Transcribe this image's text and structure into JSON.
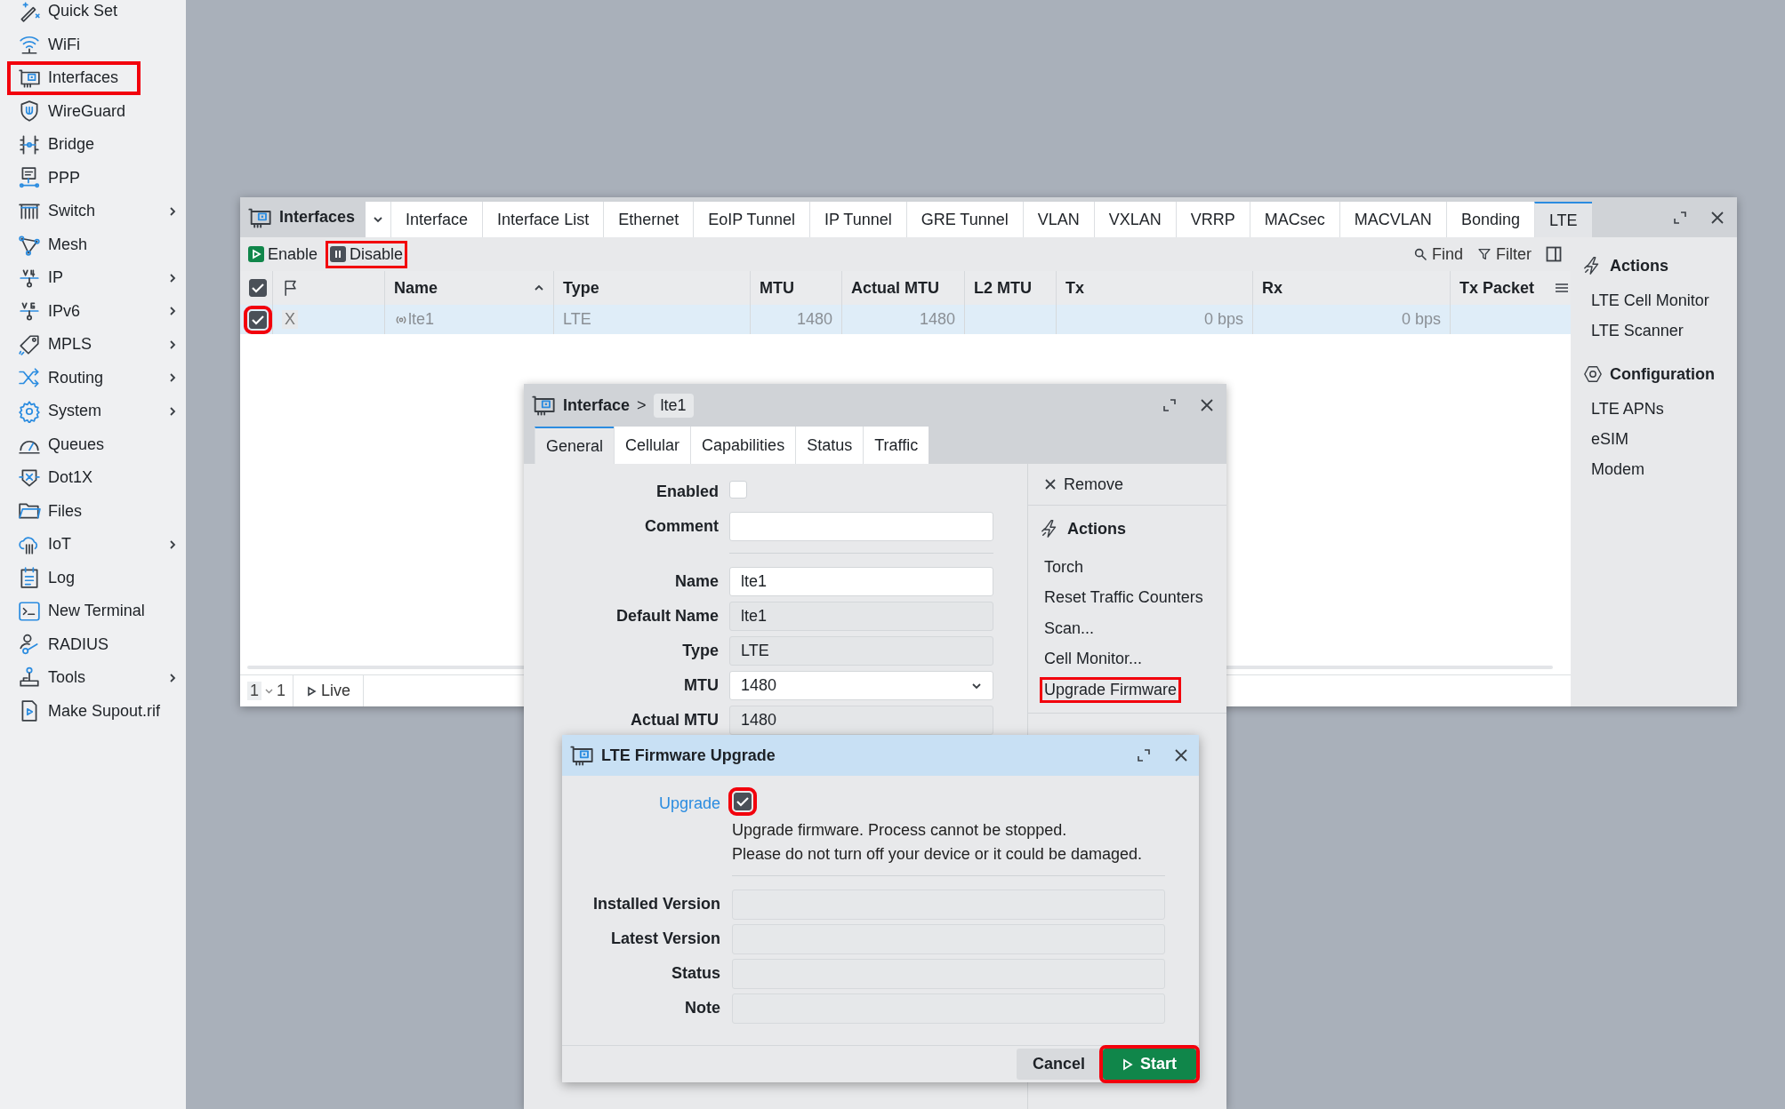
{
  "sidebar": {
    "items": [
      {
        "label": "Quick Set",
        "submenu": false,
        "highlighted": false
      },
      {
        "label": "WiFi",
        "submenu": false,
        "highlighted": false
      },
      {
        "label": "Interfaces",
        "submenu": false,
        "highlighted": true
      },
      {
        "label": "WireGuard",
        "submenu": false,
        "highlighted": false
      },
      {
        "label": "Bridge",
        "submenu": false,
        "highlighted": false
      },
      {
        "label": "PPP",
        "submenu": false,
        "highlighted": false
      },
      {
        "label": "Switch",
        "submenu": true,
        "highlighted": false
      },
      {
        "label": "Mesh",
        "submenu": false,
        "highlighted": false
      },
      {
        "label": "IP",
        "submenu": true,
        "highlighted": false
      },
      {
        "label": "IPv6",
        "submenu": true,
        "highlighted": false
      },
      {
        "label": "MPLS",
        "submenu": true,
        "highlighted": false
      },
      {
        "label": "Routing",
        "submenu": true,
        "highlighted": false
      },
      {
        "label": "System",
        "submenu": true,
        "highlighted": false
      },
      {
        "label": "Queues",
        "submenu": false,
        "highlighted": false
      },
      {
        "label": "Dot1X",
        "submenu": false,
        "highlighted": false
      },
      {
        "label": "Files",
        "submenu": false,
        "highlighted": false
      },
      {
        "label": "IoT",
        "submenu": true,
        "highlighted": false
      },
      {
        "label": "Log",
        "submenu": false,
        "highlighted": false
      },
      {
        "label": "New Terminal",
        "submenu": false,
        "highlighted": false
      },
      {
        "label": "RADIUS",
        "submenu": false,
        "highlighted": false
      },
      {
        "label": "Tools",
        "submenu": true,
        "highlighted": false
      },
      {
        "label": "Make Supout.rif",
        "submenu": false,
        "highlighted": false
      }
    ]
  },
  "interfaces_window": {
    "title": "Interfaces",
    "tabs": [
      {
        "label": "Interface",
        "selected": false
      },
      {
        "label": "Interface List",
        "selected": false
      },
      {
        "label": "Ethernet",
        "selected": false
      },
      {
        "label": "EoIP Tunnel",
        "selected": false
      },
      {
        "label": "IP Tunnel",
        "selected": false
      },
      {
        "label": "GRE Tunnel",
        "selected": false
      },
      {
        "label": "VLAN",
        "selected": false
      },
      {
        "label": "VXLAN",
        "selected": false
      },
      {
        "label": "VRRP",
        "selected": false
      },
      {
        "label": "MACsec",
        "selected": false
      },
      {
        "label": "MACVLAN",
        "selected": false
      },
      {
        "label": "Bonding",
        "selected": false
      },
      {
        "label": "LTE",
        "selected": true
      }
    ],
    "toolbar": [
      {
        "label": "Enable",
        "kind": "enable",
        "highlighted": false
      },
      {
        "label": "Disable",
        "kind": "disable",
        "highlighted": true
      }
    ],
    "tools": [
      {
        "label": "Find",
        "kind": "find"
      },
      {
        "label": "Filter",
        "kind": "filter"
      }
    ],
    "table": {
      "all_checked": true,
      "columns": [
        {
          "label": "Name",
          "sorted": true
        },
        {
          "label": "Type",
          "sorted": false
        },
        {
          "label": "MTU",
          "sorted": false
        },
        {
          "label": "Actual MTU",
          "sorted": false
        },
        {
          "label": "L2 MTU",
          "sorted": false
        },
        {
          "label": "Tx",
          "sorted": false
        },
        {
          "label": "Rx",
          "sorted": false
        },
        {
          "label": "Tx Packet",
          "sorted": false
        }
      ],
      "rows": [
        {
          "checked": true,
          "highlighted": true,
          "selected": true,
          "flag": "X",
          "cells": [
            "lte1",
            "LTE",
            "1480",
            "1480",
            null,
            "0 bps",
            "0 bps",
            null
          ]
        }
      ]
    },
    "footer": {
      "page": "1",
      "count": "1",
      "live": "Live"
    },
    "side_panel": [
      {
        "title": "Actions",
        "kind": "actions",
        "items": [
          "LTE Cell Monitor",
          "LTE Scanner"
        ]
      },
      {
        "title": "Configuration",
        "kind": "config",
        "items": [
          "LTE APNs",
          "eSIM",
          "Modem"
        ]
      }
    ]
  },
  "interface_dialog": {
    "breadcrumb": "Interface",
    "separator": ">",
    "name": "lte1",
    "tabs": [
      {
        "label": "General",
        "selected": true
      },
      {
        "label": "Cellular",
        "selected": false
      },
      {
        "label": "Capabilities",
        "selected": false
      },
      {
        "label": "Status",
        "selected": false
      },
      {
        "label": "Traffic",
        "selected": false
      }
    ],
    "fields": [
      {
        "label": "Enabled",
        "kind": "checkbox",
        "checked": false
      },
      {
        "label": "Comment",
        "kind": "text"
      },
      {
        "kind": "separator"
      },
      {
        "label": "Name",
        "kind": "text",
        "value": "lte1"
      },
      {
        "label": "Default Name",
        "kind": "readonly",
        "value": "lte1"
      },
      {
        "label": "Type",
        "kind": "readonly",
        "value": "LTE"
      },
      {
        "label": "MTU",
        "kind": "select",
        "value": "1480"
      },
      {
        "label": "Actual MTU",
        "kind": "readonly",
        "value": "1480"
      }
    ],
    "remove": "Remove",
    "actions_title": "Actions",
    "actions": [
      {
        "label": "Torch",
        "highlighted": false
      },
      {
        "label": "Reset Traffic Counters",
        "highlighted": false
      },
      {
        "label": "Scan...",
        "highlighted": false
      },
      {
        "label": "Cell Monitor...",
        "highlighted": false
      },
      {
        "label": "Upgrade Firmware",
        "highlighted": true
      }
    ]
  },
  "upgrade_dialog": {
    "title": "LTE Firmware Upgrade",
    "upgrade": {
      "label": "Upgrade",
      "checked": true,
      "highlighted": true
    },
    "notes": [
      "Upgrade firmware. Process cannot be stopped.",
      "Please do not turn off your device or it could be damaged."
    ],
    "fields": [
      {
        "label": "Installed Version"
      },
      {
        "label": "Latest Version"
      },
      {
        "label": "Status"
      },
      {
        "label": "Note"
      }
    ],
    "buttons": [
      {
        "label": "Cancel",
        "kind": "cancel",
        "highlighted": false
      },
      {
        "label": "Start",
        "kind": "start",
        "highlighted": true
      }
    ]
  }
}
